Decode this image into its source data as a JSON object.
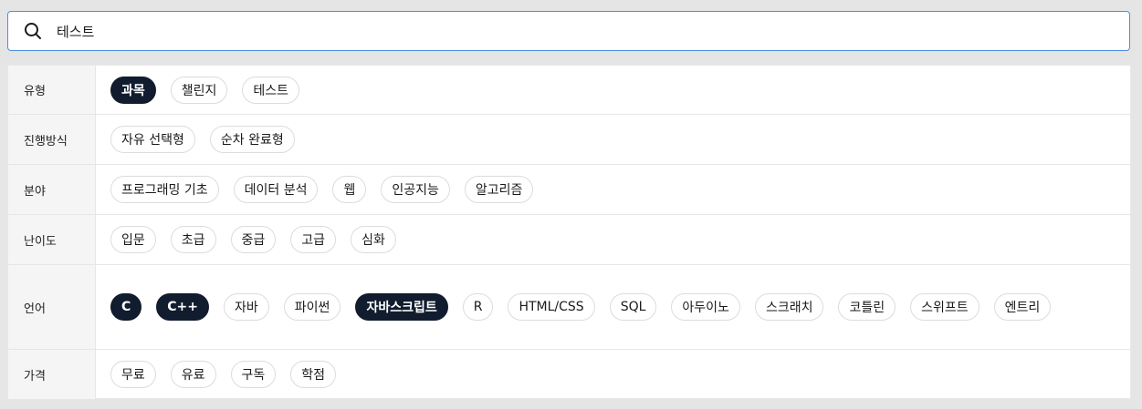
{
  "search": {
    "value": "테스트",
    "icon": "search-icon"
  },
  "filters": [
    {
      "label": "유형",
      "options": [
        {
          "text": "과목",
          "active": true
        },
        {
          "text": "챌린지",
          "active": false
        },
        {
          "text": "테스트",
          "active": false
        }
      ]
    },
    {
      "label": "진행방식",
      "options": [
        {
          "text": "자유 선택형",
          "active": false
        },
        {
          "text": "순차 완료형",
          "active": false
        }
      ]
    },
    {
      "label": "분야",
      "options": [
        {
          "text": "프로그래밍 기초",
          "active": false
        },
        {
          "text": "데이터 분석",
          "active": false
        },
        {
          "text": "웹",
          "active": false
        },
        {
          "text": "인공지능",
          "active": false
        },
        {
          "text": "알고리즘",
          "active": false
        }
      ]
    },
    {
      "label": "난이도",
      "options": [
        {
          "text": "입문",
          "active": false
        },
        {
          "text": "초급",
          "active": false
        },
        {
          "text": "중급",
          "active": false
        },
        {
          "text": "고급",
          "active": false
        },
        {
          "text": "심화",
          "active": false
        }
      ]
    },
    {
      "label": "언어",
      "options": [
        {
          "text": "C",
          "active": true
        },
        {
          "text": "C++",
          "active": true
        },
        {
          "text": "자바",
          "active": false
        },
        {
          "text": "파이썬",
          "active": false
        },
        {
          "text": "자바스크립트",
          "active": true
        },
        {
          "text": "R",
          "active": false
        },
        {
          "text": "HTML/CSS",
          "active": false
        },
        {
          "text": "SQL",
          "active": false
        },
        {
          "text": "아두이노",
          "active": false
        },
        {
          "text": "스크래치",
          "active": false
        },
        {
          "text": "코틀린",
          "active": false
        },
        {
          "text": "스위프트",
          "active": false
        },
        {
          "text": "엔트리",
          "active": false
        }
      ]
    },
    {
      "label": "가격",
      "options": [
        {
          "text": "무료",
          "active": false
        },
        {
          "text": "유료",
          "active": false
        },
        {
          "text": "구독",
          "active": false
        },
        {
          "text": "학점",
          "active": false
        }
      ]
    }
  ],
  "colors": {
    "active_chip": "#111c2e",
    "search_border": "#4a90d9"
  }
}
